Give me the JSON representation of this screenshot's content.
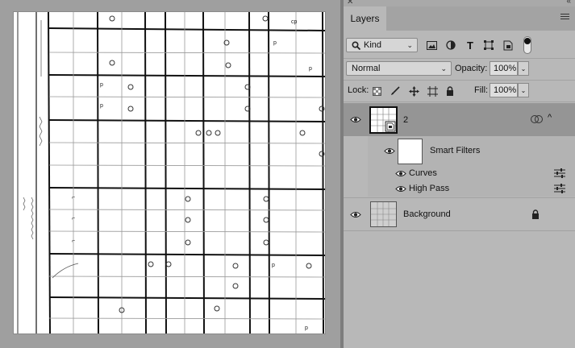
{
  "panel": {
    "collapse_glyph": "«",
    "close_glyph": "✕",
    "tab_label": "Layers",
    "menu_icon": "hamburger-icon"
  },
  "filter_row": {
    "kind_label": "Kind",
    "icons": [
      "image-filter-icon",
      "adjustment-filter-icon",
      "type-filter-icon",
      "shape-filter-icon",
      "smart-object-filter-icon",
      "filter-toggle-icon"
    ]
  },
  "blend_row": {
    "mode": "Normal",
    "opacity_label": "Opacity:",
    "opacity_value": "100%"
  },
  "lock_row": {
    "lock_label": "Lock:",
    "fill_label": "Fill:",
    "fill_value": "100%"
  },
  "layers": [
    {
      "name": "2",
      "type": "smart-object",
      "selected": true
    },
    {
      "name": "Smart Filters",
      "type": "smart-filters"
    },
    {
      "name": "Curves",
      "type": "filter"
    },
    {
      "name": "High Pass",
      "type": "filter"
    },
    {
      "name": "Background",
      "type": "background",
      "locked": true
    }
  ],
  "colors": {
    "panel_bg": "#b8b8b8",
    "selected_row": "#959595",
    "canvas_bg": "#9f9f9f"
  }
}
